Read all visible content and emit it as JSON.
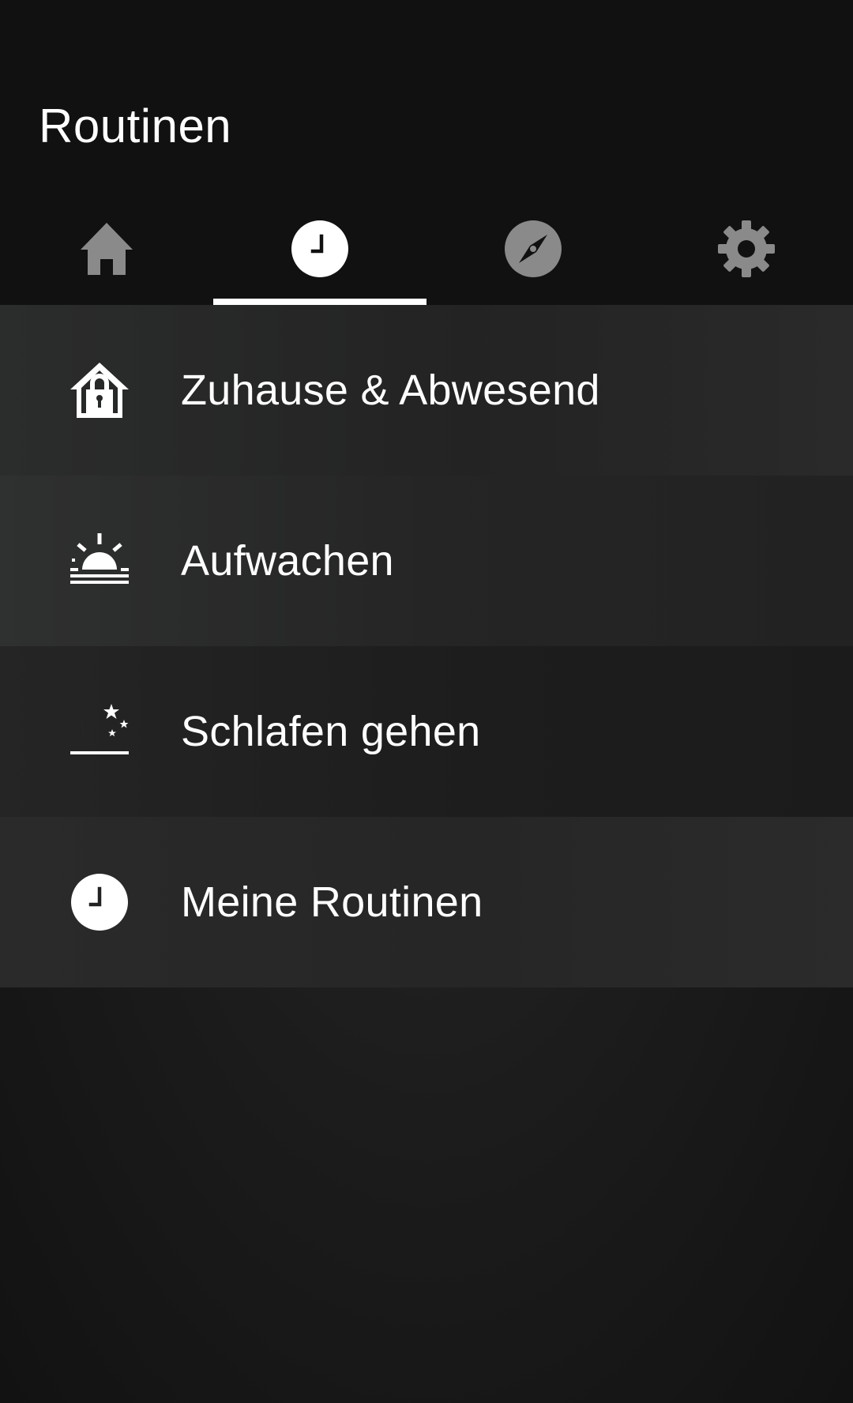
{
  "header": {
    "title": "Routinen"
  },
  "tabs": [
    {
      "icon": "home-icon",
      "active": false
    },
    {
      "icon": "clock-icon",
      "active": true
    },
    {
      "icon": "compass-icon",
      "active": false
    },
    {
      "icon": "gear-icon",
      "active": false
    }
  ],
  "routines": [
    {
      "label": "Zuhause & Abwesend",
      "icon": "home-lock-icon"
    },
    {
      "label": "Aufwachen",
      "icon": "sunrise-icon"
    },
    {
      "label": "Schlafen gehen",
      "icon": "moon-stars-icon"
    },
    {
      "label": "Meine Routinen",
      "icon": "clock-icon"
    }
  ],
  "colors": {
    "background": "#121212",
    "active_tab": "#ffffff",
    "inactive_tab": "#8a8a8a",
    "text": "#ffffff"
  }
}
